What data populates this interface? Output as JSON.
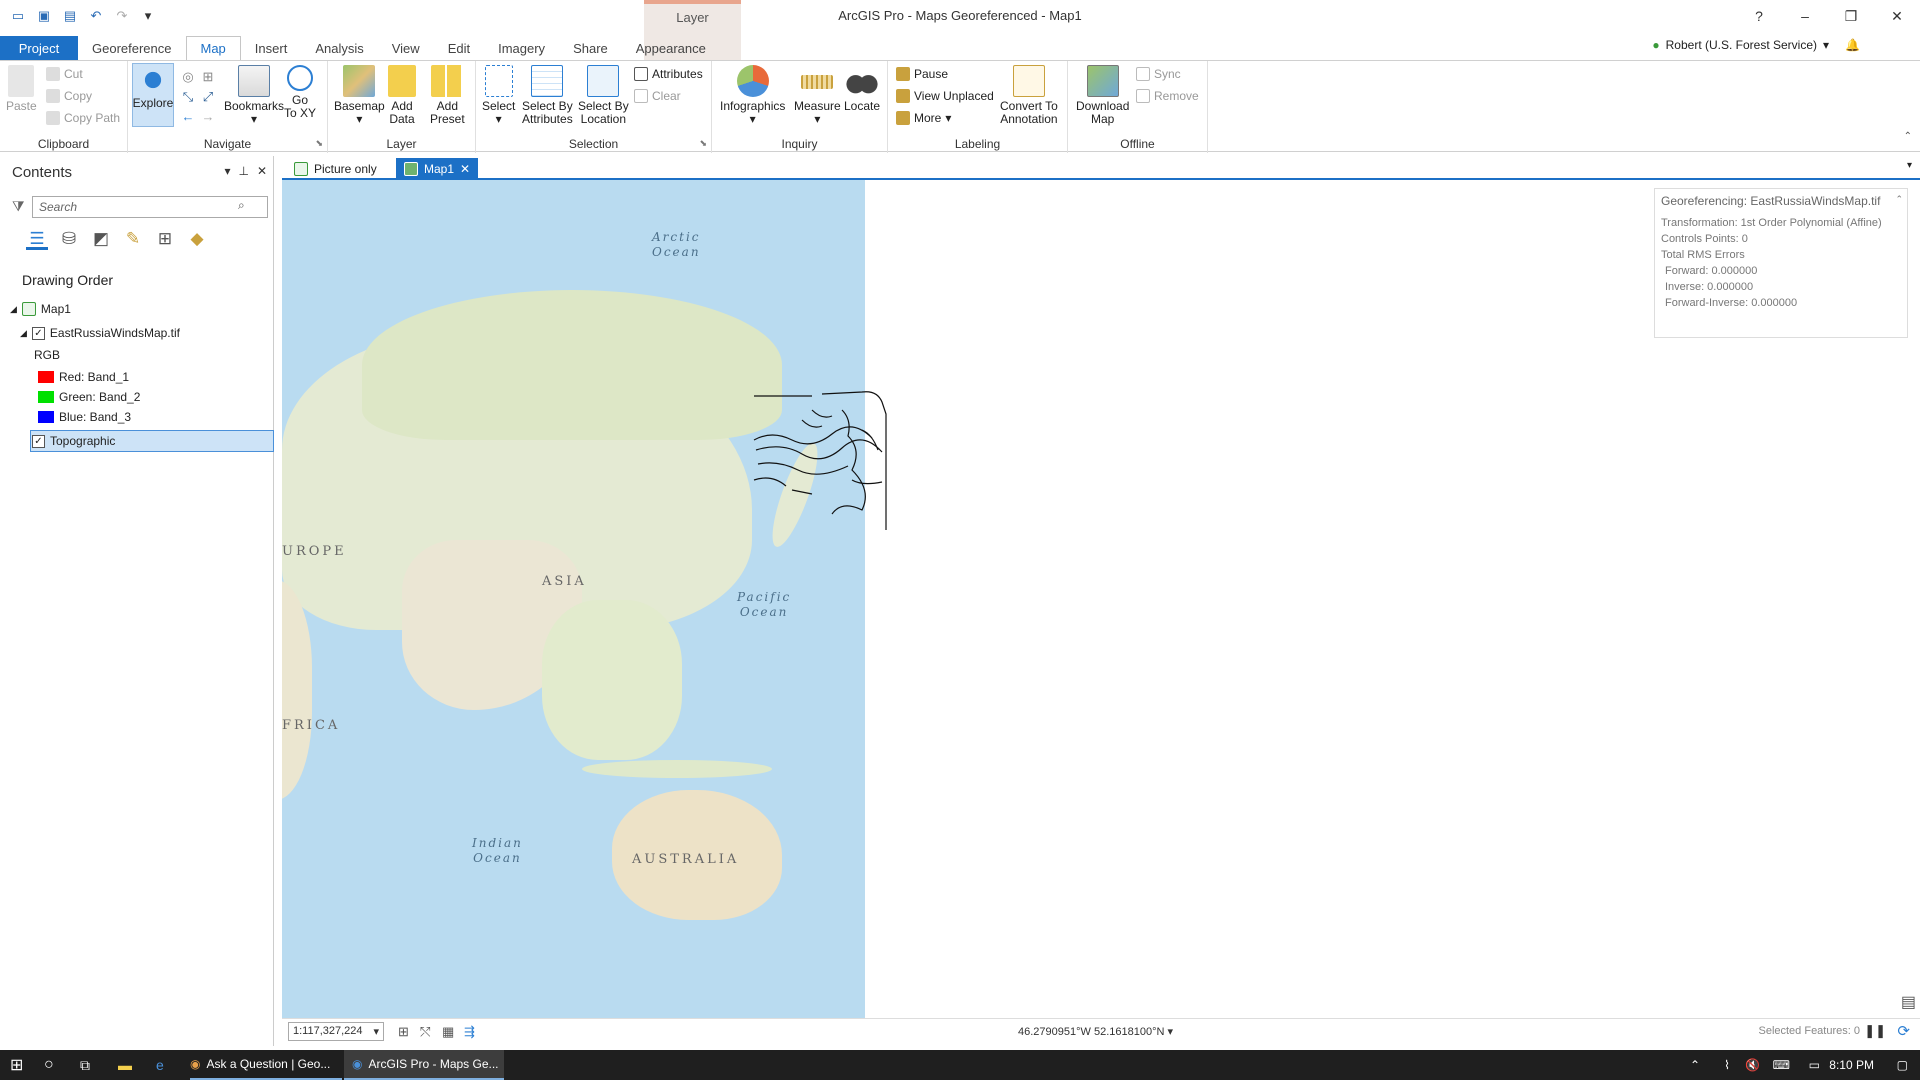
{
  "window": {
    "title": "ArcGIS Pro - Maps Georeferenced - Map1",
    "context_tab_group": "Layer",
    "help": "?",
    "minimize": "–",
    "restore": "❐",
    "close": "✕"
  },
  "ribbon_tabs": [
    "Project",
    "Georeference",
    "Map",
    "Insert",
    "Analysis",
    "View",
    "Edit",
    "Imagery",
    "Share",
    "Appearance"
  ],
  "user": "Robert (U.S. Forest Service)",
  "clipboard": {
    "paste": "Paste",
    "cut": "Cut",
    "copy": "Copy",
    "copy_path": "Copy Path",
    "label": "Clipboard"
  },
  "navigate": {
    "explore": "Explore",
    "bookmarks": "Bookmarks",
    "go_to_xy_1": "Go",
    "go_to_xy_2": "To XY",
    "label": "Navigate"
  },
  "layer": {
    "basemap": "Basemap",
    "add_data_1": "Add",
    "add_data_2": "Data",
    "add_preset_1": "Add",
    "add_preset_2": "Preset",
    "label": "Layer"
  },
  "selection": {
    "select": "Select",
    "by_attr_1": "Select By",
    "by_attr_2": "Attributes",
    "by_loc_1": "Select By",
    "by_loc_2": "Location",
    "attributes": "Attributes",
    "clear": "Clear",
    "label": "Selection"
  },
  "inquiry": {
    "infographics": "Infographics",
    "measure": "Measure",
    "locate": "Locate",
    "label": "Inquiry"
  },
  "labeling": {
    "pause": "Pause",
    "view_unplaced": "View Unplaced",
    "more": "More",
    "convert_1": "Convert To",
    "convert_2": "Annotation",
    "label": "Labeling"
  },
  "offline": {
    "download_1": "Download",
    "download_2": "Map",
    "sync": "Sync",
    "remove": "Remove",
    "label": "Offline"
  },
  "contents": {
    "title": "Contents",
    "search_placeholder": "Search",
    "drawing_order": "Drawing Order",
    "map_name": "Map1",
    "layer_name": "EastRussiaWindsMap.tif",
    "rgb": "RGB",
    "bands": [
      {
        "label": "Red:  Band_1",
        "color": "#ff0000"
      },
      {
        "label": "Green: Band_2",
        "color": "#00e000"
      },
      {
        "label": "Blue:  Band_3",
        "color": "#0000ff"
      }
    ],
    "basemap_layer": "Topographic"
  },
  "map_tabs": [
    {
      "label": "Picture only"
    },
    {
      "label": "Map1"
    }
  ],
  "map_labels": {
    "arctic": "Arctic\nOcean",
    "pacific": "Pacific\nOcean",
    "indian": "Indian\nOcean",
    "europe": "UROPE",
    "asia": "ASIA",
    "africa": "FRICA",
    "australia": "AUSTRALIA"
  },
  "georef_info": {
    "title": "Georeferencing: EastRussiaWindsMap.tif",
    "transformation": "Transformation: 1st Order Polynomial (Affine)",
    "controls": "Controls Points: 0",
    "rms": "Total RMS Errors",
    "forward": "Forward: 0.000000",
    "inverse": "Inverse: 0.000000",
    "forward_inverse": "Forward-Inverse: 0.000000"
  },
  "status": {
    "scale": "1:117,327,224",
    "coords": "46.2790951°W 52.1618100°N",
    "selected": "Selected Features: 0"
  },
  "taskbar": {
    "app1": "Ask a Question | Geo...",
    "app2": "ArcGIS Pro - Maps Ge...",
    "time": "8:10 PM"
  }
}
